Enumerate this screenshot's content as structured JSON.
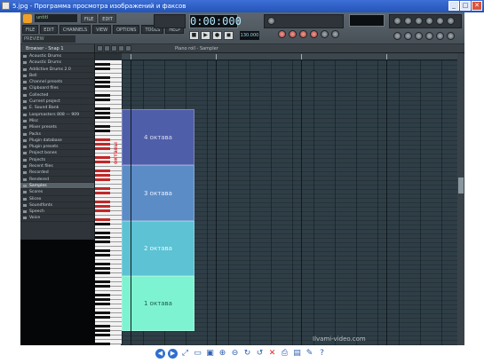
{
  "viewer": {
    "title": "5.jpg - Программа просмотра изображений и факсов",
    "controls": [
      "_",
      "□",
      "✕"
    ],
    "toolbar": [
      {
        "name": "prev-image-button",
        "glyph": "◀",
        "style": "round"
      },
      {
        "name": "next-image-button",
        "glyph": "▶",
        "style": "round"
      },
      {
        "name": "best-fit-button",
        "glyph": "⤢"
      },
      {
        "name": "actual-size-button",
        "glyph": "▭"
      },
      {
        "name": "slideshow-button",
        "glyph": "▣"
      },
      {
        "name": "zoom-in-button",
        "glyph": "⊕"
      },
      {
        "name": "zoom-out-button",
        "glyph": "⊖"
      },
      {
        "name": "rotate-cw-button",
        "glyph": "↻"
      },
      {
        "name": "rotate-ccw-button",
        "glyph": "↺"
      },
      {
        "name": "delete-button",
        "glyph": "✕",
        "style": "red"
      },
      {
        "name": "print-button",
        "glyph": "⎙"
      },
      {
        "name": "save-button",
        "glyph": "▤"
      },
      {
        "name": "edit-button",
        "glyph": "✎"
      },
      {
        "name": "help-button",
        "glyph": "?"
      }
    ]
  },
  "fl": {
    "song_name": "untitl",
    "menu": [
      "FILE",
      "EDIT",
      "CHANNELS",
      "VIEW",
      "OPTIONS",
      "TOOLS",
      "HELP"
    ],
    "row2": [
      "PAT",
      "SONG",
      "",
      "",
      ""
    ],
    "hint": "PREVIEW",
    "time": "0:00:000",
    "tempo": "130.000",
    "transport": [
      "■",
      "▶",
      "●",
      "◼"
    ]
  },
  "browser": {
    "header": "Browser - Snap 1",
    "items": [
      "Acoustic Drums",
      "Acoustic Drums",
      "Addictive Drums 2.0",
      "Bell",
      "Channel presets",
      "Clipboard files",
      "Collected",
      "Current project",
      "E. Sound Bank",
      "Loopmasters 808 — 909",
      "Misc",
      "Mixer presets",
      "Packs",
      "Plugin database",
      "Plugin presets",
      "Project bones",
      "Projects",
      "Recent files",
      "Recorded",
      "Rendered",
      "Samples",
      "Scores",
      "Slicex",
      "Soundfonts",
      "Speech",
      "Voice"
    ],
    "selected_index": 20
  },
  "piano_roll": {
    "title": "Piano roll - Sampler",
    "side_label": "октавы",
    "octaves": [
      "4 октава",
      "3 октава",
      "2 октава",
      "1 октава"
    ]
  },
  "watermark": "Ilvami-video.com"
}
